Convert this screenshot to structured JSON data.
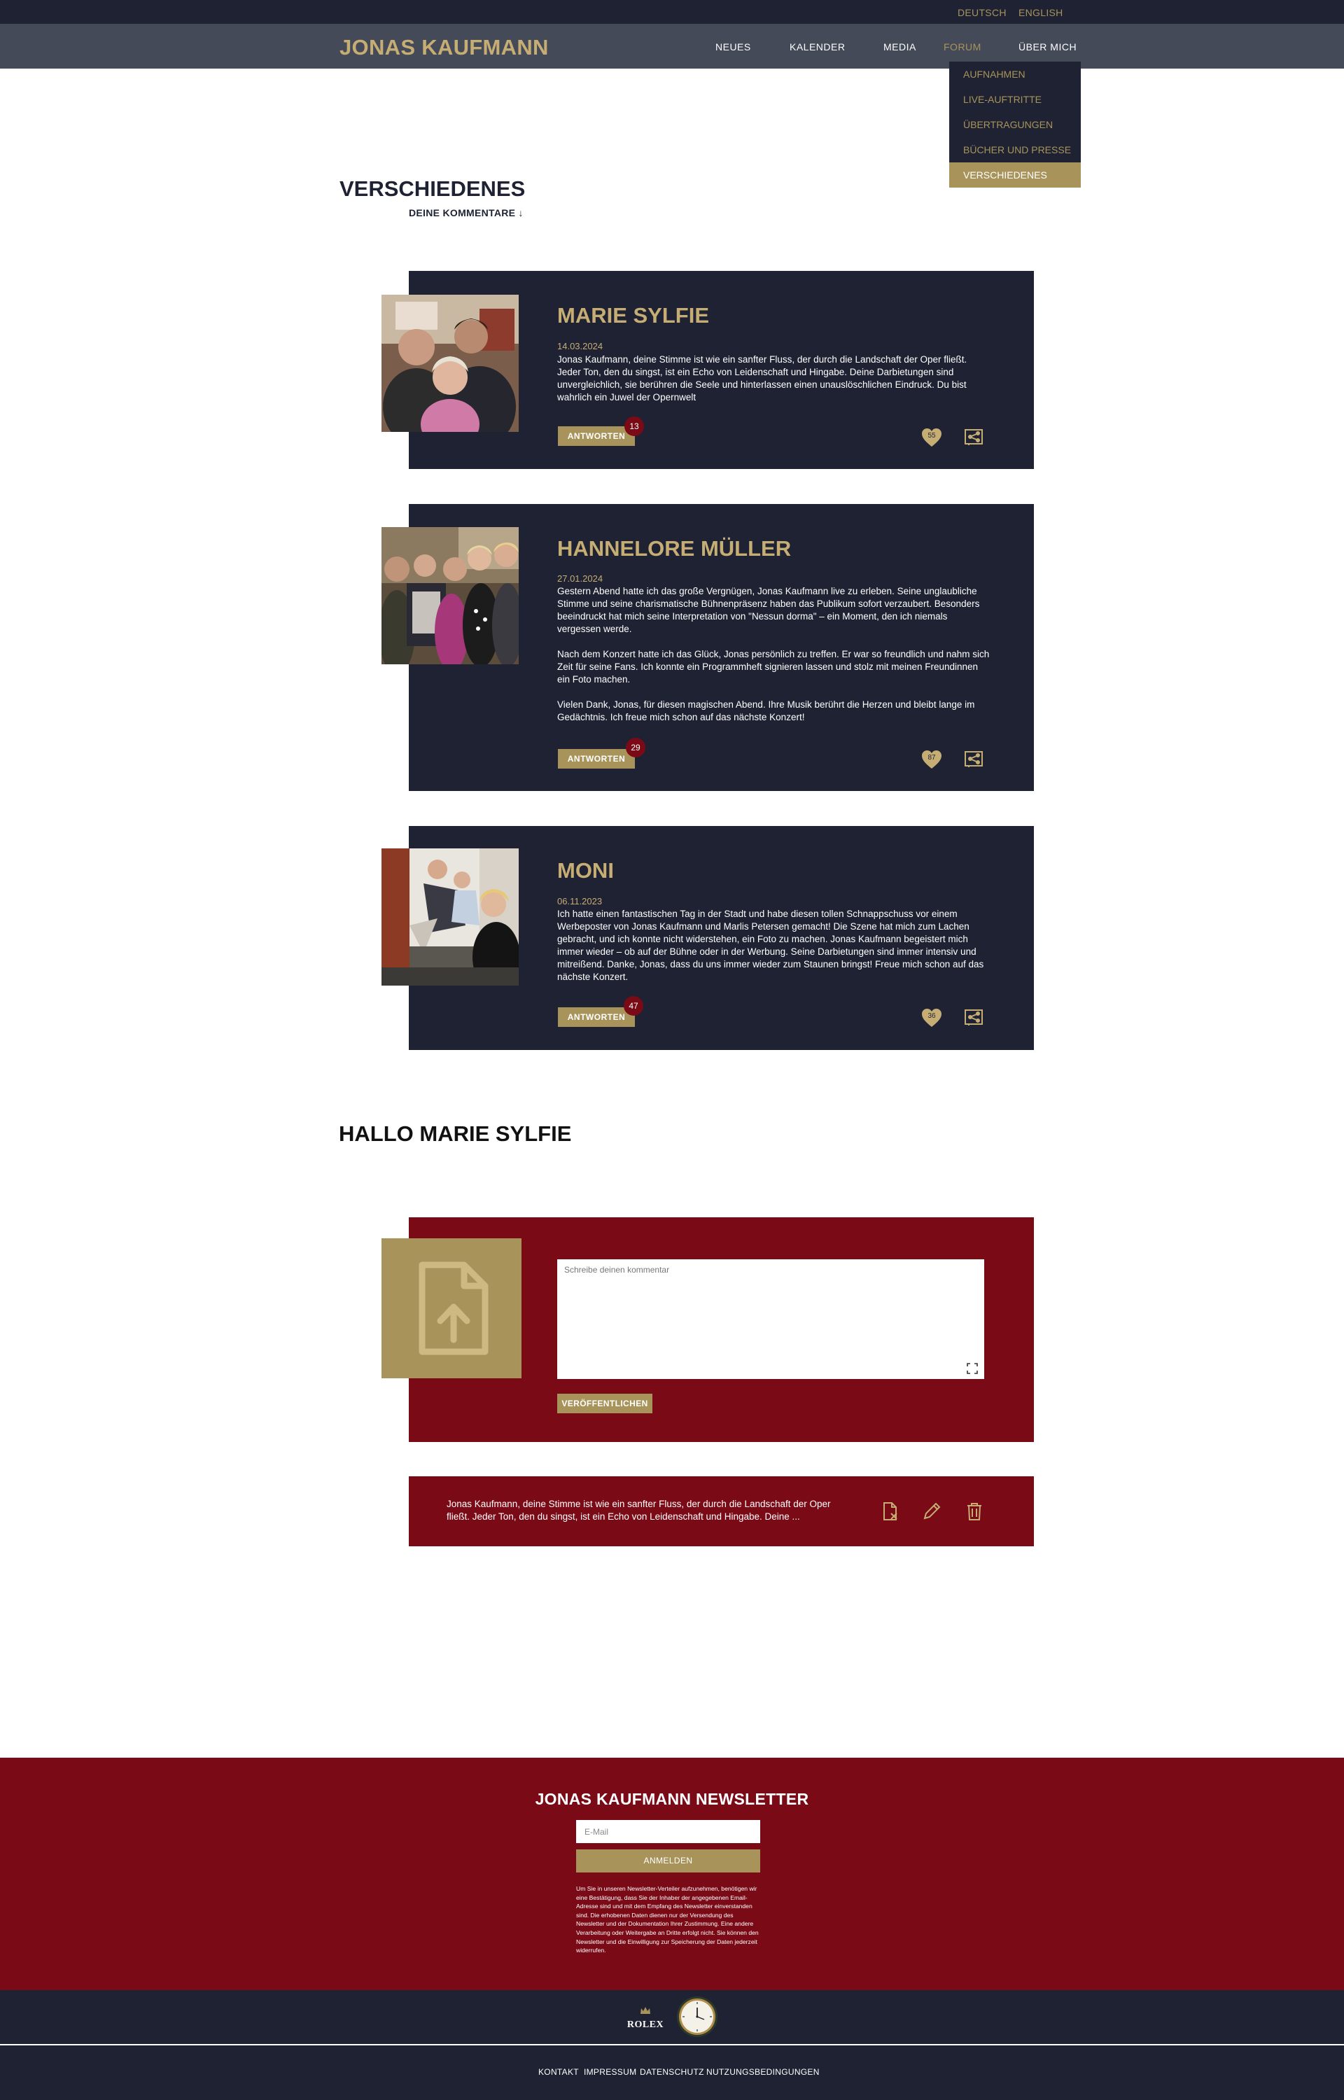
{
  "languages": [
    "DEUTSCH",
    "ENGLISH"
  ],
  "header": {
    "logo": "JONAS KAUFMANN",
    "nav": [
      "NEUES",
      "KALENDER",
      "MEDIA",
      "FORUM",
      "ÜBER MICH"
    ],
    "active_nav": "FORUM"
  },
  "dropdown": {
    "items": [
      "AUFNAHMEN",
      "LIVE-AUFTRITTE",
      "ÜBERTRAGUNGEN",
      "BÜCHER UND PRESSE",
      "VERSCHIEDENES"
    ],
    "active": "VERSCHIEDENES"
  },
  "page": {
    "title": "VERSCHIEDENES",
    "sub_link": "DEINE KOMMENTARE ↓"
  },
  "comments": [
    {
      "name": "MARIE SYLFIE",
      "date": "14.03.2024",
      "paragraphs": [
        "Jonas Kaufmann, deine Stimme ist wie ein sanfter Fluss, der durch die Landschaft der Oper fließt. Jeder Ton, den du singst, ist ein Echo von Leidenschaft und Hingabe. Deine Darbietungen sind unvergleichlich, sie berühren die Seele und hinterlassen einen unauslöschlichen Eindruck. Du bist wahrlich ein Juwel der Opernwelt"
      ],
      "reply_label": "ANTWORTEN",
      "reply_count": "13",
      "likes": "55"
    },
    {
      "name": "HANNELORE MÜLLER",
      "date": "27.01.2024",
      "paragraphs": [
        "Gestern Abend hatte ich das große Vergnügen, Jonas Kaufmann live zu erleben. Seine unglaubliche Stimme und seine charismatische Bühnenpräsenz haben das Publikum sofort verzaubert. Besonders beeindruckt hat mich seine Interpretation von \"Nessun dorma\" – ein Moment, den ich niemals vergessen werde.",
        "Nach dem Konzert hatte ich das Glück, Jonas persönlich zu treffen. Er war so freundlich und nahm sich Zeit für seine Fans. Ich konnte ein Programmheft signieren lassen und stolz mit meinen Freundinnen ein Foto machen.",
        "Vielen Dank, Jonas, für diesen magischen Abend. Ihre Musik berührt die Herzen und bleibt lange im Gedächtnis. Ich freue mich schon auf das nächste Konzert!"
      ],
      "reply_label": "ANTWORTEN",
      "reply_count": "29",
      "likes": "87"
    },
    {
      "name": "MONI",
      "date": "06.11.2023",
      "paragraphs": [
        "Ich hatte einen fantastischen Tag in der Stadt und habe diesen tollen Schnappschuss vor einem Werbeposter von Jonas Kaufmann und Marlis Petersen gemacht! Die Szene hat mich zum Lachen gebracht, und ich konnte nicht widerstehen, ein Foto zu machen. Jonas Kaufmann begeistert mich immer wieder – ob auf der Bühne oder in der Werbung. Seine Darbietungen sind immer intensiv und mitreißend. Danke, Jonas, dass du uns immer wieder zum Staunen bringst! Freue mich schon auf das nächste Konzert."
      ],
      "reply_label": "ANTWORTEN",
      "reply_count": "47",
      "likes": "36"
    }
  ],
  "greeting": "HALLO MARIE SYLFIE",
  "compose": {
    "placeholder": "Schreibe deinen kommentar",
    "publish_label": "VERÖFFENTLICHEN"
  },
  "own_comment": {
    "text": "Jonas Kaufmann, deine Stimme ist wie ein sanfter Fluss, der durch die Landschaft der Oper fließt. Jeder Ton, den du singst, ist ein Echo von Leidenschaft und Hingabe. Deine ...",
    "icons": [
      "remove-file-icon",
      "edit-pencil-icon",
      "trash-icon"
    ]
  },
  "newsletter": {
    "title": "JONAS KAUFMANN NEWSLETTER",
    "email_placeholder": "E-Mail",
    "button_label": "ANMELDEN",
    "legal": "Um Sie in unseren Newsletter-Verteiler aufzunehmen, benötigen wir eine Bestätigung, dass Sie der Inhaber der angegebenen Email-Adresse sind und mit dem Empfang des Newsletter einverstanden sind. Die erhobenen Daten dienen nur der Versendung des Newsletter und der Dokumentation Ihrer Zustimmung. Eine andere Verarbeitung oder Weitergabe an Dritte erfolgt nicht. Sie können den Newsletter und die Einwilligung zur Speicherung der Daten jederzeit widerrufen."
  },
  "sponsor": {
    "name": "ROLEX"
  },
  "footer": {
    "links": [
      "KONTAKT",
      "IMPRESSUM",
      "DATENSCHUTZ",
      "NUTZUNGSBEDINGUNGEN"
    ]
  },
  "colors": {
    "navy": "#1e2233",
    "header_gray": "#454a58",
    "gold": "#a8945a",
    "gold_light": "#c5ad74",
    "burgundy": "#7a0a16"
  }
}
